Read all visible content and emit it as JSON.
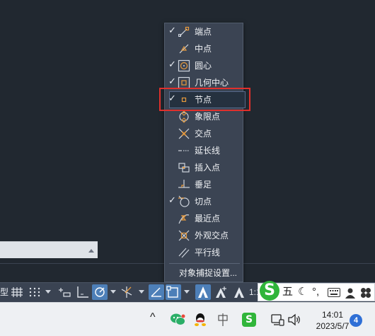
{
  "osnap_menu": {
    "items": [
      {
        "label": "端点",
        "checked": "✓",
        "icon": "endpoint-snap-icon"
      },
      {
        "label": "中点",
        "checked": "",
        "icon": "midpoint-snap-icon"
      },
      {
        "label": "圆心",
        "checked": "✓",
        "icon": "center-snap-icon"
      },
      {
        "label": "几何中心",
        "checked": "✓",
        "icon": "geometric-center-snap-icon"
      },
      {
        "label": "节点",
        "checked": "✓",
        "icon": "node-snap-icon"
      },
      {
        "label": "象限点",
        "checked": "",
        "icon": "quadrant-snap-icon"
      },
      {
        "label": "交点",
        "checked": "",
        "icon": "intersection-snap-icon"
      },
      {
        "label": "延长线",
        "checked": "",
        "icon": "extension-snap-icon"
      },
      {
        "label": "插入点",
        "checked": "",
        "icon": "insertion-snap-icon"
      },
      {
        "label": "垂足",
        "checked": "",
        "icon": "perpendicular-snap-icon"
      },
      {
        "label": "切点",
        "checked": "✓",
        "icon": "tangent-snap-icon"
      },
      {
        "label": "最近点",
        "checked": "",
        "icon": "nearest-snap-icon"
      },
      {
        "label": "外观交点",
        "checked": "",
        "icon": "apparent-intersection-snap-icon"
      },
      {
        "label": "平行线",
        "checked": "",
        "icon": "parallel-snap-icon"
      }
    ],
    "settings_label": "对象捕捉设置..."
  },
  "statusbar": {
    "left_partial": "型",
    "scale_label": "1:1"
  },
  "ime": {
    "mode": "五",
    "moon": "☾",
    "punct": "°,"
  },
  "taskbar": {
    "time": "14:01",
    "date": "2023/5/7",
    "notification_count": "4",
    "tray_chevron": "^"
  },
  "colors": {
    "menu_bg": "#3b4453",
    "snap_orange": "#e89a3c",
    "highlight_red": "#e0302c",
    "statusbar_active": "#4d7fb8"
  }
}
